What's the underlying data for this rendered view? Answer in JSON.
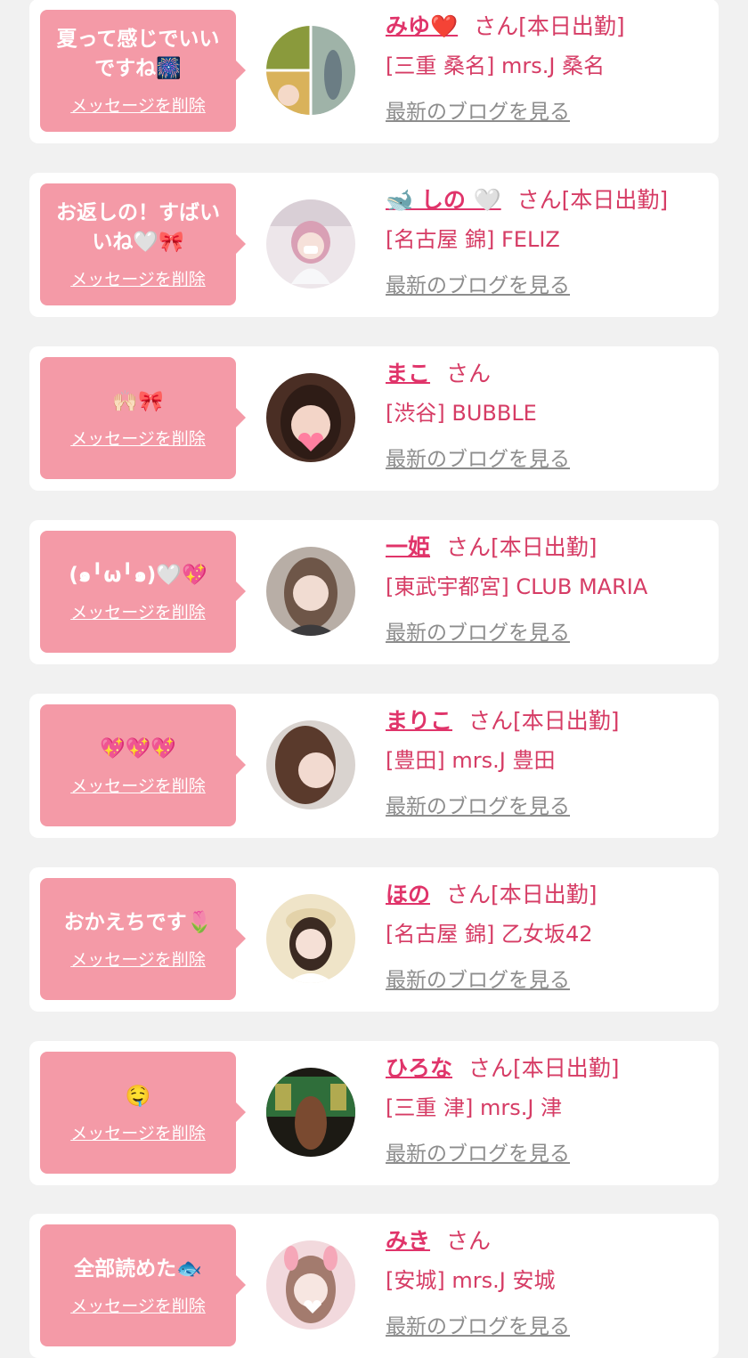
{
  "colors": {
    "bubble": "#f49aa7",
    "name": "#e0346a",
    "text": "#d63c65",
    "link_gray": "#8d8d8d",
    "background": "#f1f1f1"
  },
  "items": [
    {
      "message": "夏って感じでいいですね🎆",
      "delete_label": "メッセージを削除",
      "name": "みゆ❤️",
      "suffix": "さん[本日出勤]",
      "shop": "[三重 桑名] mrs.J 桑名",
      "blog_label": "最新のブログを見る"
    },
    {
      "message": "お返しの！すばいいね🤍🎀",
      "delete_label": "メッセージを削除",
      "name": "🐋 しの 🤍",
      "suffix": "さん[本日出勤]",
      "shop": "[名古屋 錦] FELIZ",
      "blog_label": "最新のブログを見る"
    },
    {
      "message": "🙌🏻🎀",
      "delete_label": "メッセージを削除",
      "name": "まこ",
      "suffix": "さん",
      "shop": "[渋谷] BUBBLE",
      "blog_label": "最新のブログを見る"
    },
    {
      "message": "(๑╹ω╹๑)🤍💖",
      "delete_label": "メッセージを削除",
      "name": "一姫",
      "suffix": "さん[本日出勤]",
      "shop": "[東武宇都宮] CLUB MARIA",
      "blog_label": "最新のブログを見る"
    },
    {
      "message": "💖💖💖",
      "delete_label": "メッセージを削除",
      "name": "まりこ",
      "suffix": "さん[本日出勤]",
      "shop": "[豊田] mrs.J 豊田",
      "blog_label": "最新のブログを見る"
    },
    {
      "message": "おかえちです🌷",
      "delete_label": "メッセージを削除",
      "name": "ほの",
      "suffix": "さん[本日出勤]",
      "shop": "[名古屋 錦] 乙女坂42",
      "blog_label": "最新のブログを見る"
    },
    {
      "message": "🤤",
      "delete_label": "メッセージを削除",
      "name": "ひろな",
      "suffix": "さん[本日出勤]",
      "shop": "[三重 津] mrs.J 津",
      "blog_label": "最新のブログを見る"
    },
    {
      "message": "全部読めた🐟",
      "delete_label": "メッセージを削除",
      "name": "みき",
      "suffix": "さん",
      "shop": "[安城] mrs.J 安城",
      "blog_label": "最新のブログを見る"
    }
  ]
}
